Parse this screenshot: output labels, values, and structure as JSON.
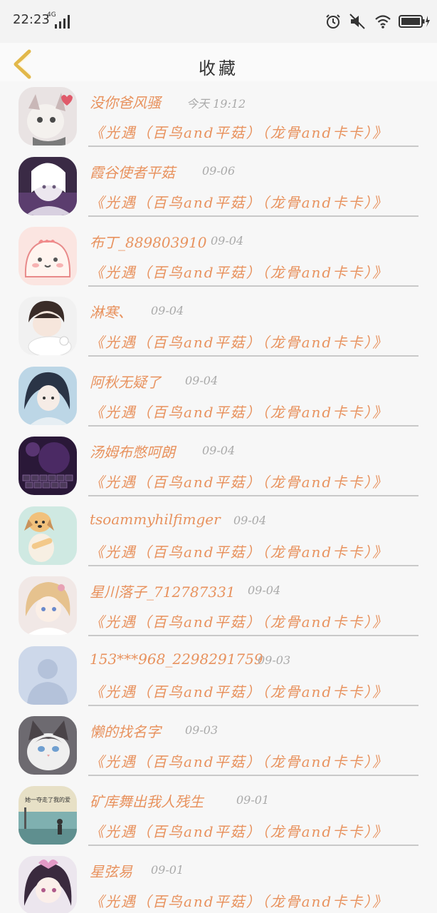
{
  "status": {
    "time": "22:23",
    "network": "4G"
  },
  "header": {
    "title": "收藏"
  },
  "items": [
    {
      "name": "没你爸风骚",
      "date": "今天 19:12",
      "book": "《光遇（百鸟and平菇）（龙骨and卡卡）》"
    },
    {
      "name": "霞谷使者平菇",
      "date": "09-06",
      "book": "《光遇（百鸟and平菇）（龙骨and卡卡）》"
    },
    {
      "name": "布丁_889803910",
      "date": "09-04",
      "book": "《光遇（百鸟and平菇）（龙骨and卡卡）》"
    },
    {
      "name": "淋寒、",
      "date": "09-04",
      "book": "《光遇（百鸟and平菇）（龙骨and卡卡）》"
    },
    {
      "name": "阿秋无疑了",
      "date": "09-04",
      "book": "《光遇（百鸟and平菇）（龙骨and卡卡）》"
    },
    {
      "name": "汤姆布憋呵朗",
      "date": "09-04",
      "book": "《光遇（百鸟and平菇）（龙骨and卡卡）》"
    },
    {
      "name": "tsoammyhilfimger",
      "date": "09-04",
      "book": "《光遇（百鸟and平菇）（龙骨and卡卡）》"
    },
    {
      "name": "星川落子_712787331",
      "date": "09-04",
      "book": "《光遇（百鸟and平菇）（龙骨and卡卡）》"
    },
    {
      "name": "153***968_2298291759",
      "date": "09-03",
      "book": "《光遇（百鸟and平菇）（龙骨and卡卡）》"
    },
    {
      "name": "懒的找名字",
      "date": "09-03",
      "book": "《光遇（百鸟and平菇）（龙骨and卡卡）》"
    },
    {
      "name": "矿库舞出我人残生",
      "date": "09-01",
      "book": "《光遇（百鸟and平菇）（龙骨and卡卡）》"
    },
    {
      "name": "星弦易",
      "date": "09-01",
      "book": "《光遇（百鸟and平菇）（龙骨and卡卡）》"
    }
  ],
  "avatars": [
    "white-cat-anime",
    "white-hair-anime-girl",
    "pink-cartoon-blob",
    "dark-hair-boy-with-dog",
    "anime-girl-blue",
    "purple-keyboard",
    "dog-with-bone",
    "blonde-anime-girl",
    "default-person-icon",
    "ragdoll-cat",
    "seaside-silhouette",
    "anime-girl-purple"
  ],
  "avatar_texts": {
    "10": "她一夺走了我的爱"
  },
  "colors": {
    "accent": "#e8925e",
    "date": "#aaaaaa",
    "back_arrow": "#e2b84a",
    "divider": "#c9c9c9"
  }
}
